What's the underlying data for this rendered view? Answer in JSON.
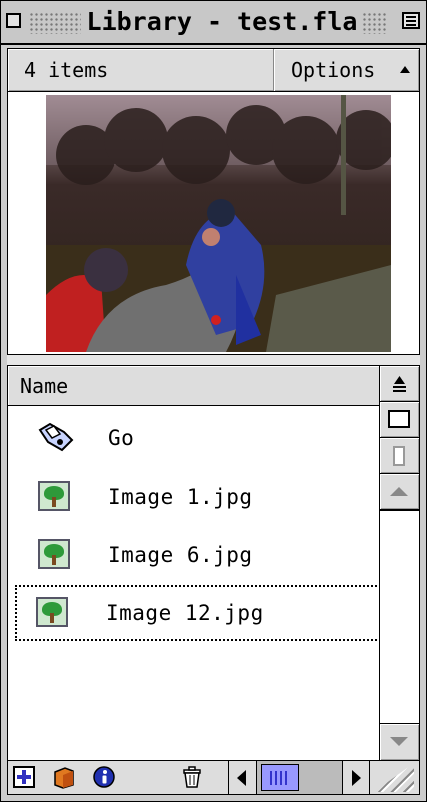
{
  "window": {
    "title": "Library - test.fla"
  },
  "header": {
    "item_count": "4 items",
    "options_label": "Options"
  },
  "list": {
    "column_header": "Name",
    "items": [
      {
        "label": "Go",
        "icon": "button-symbol-icon"
      },
      {
        "label": "Image 1.jpg",
        "icon": "bitmap-icon"
      },
      {
        "label": "Image 6.jpg",
        "icon": "bitmap-icon"
      },
      {
        "label": "Image 12.jpg",
        "icon": "bitmap-icon",
        "selected": true
      }
    ]
  },
  "toolbar": {
    "icons": [
      "new-symbol-icon",
      "new-folder-icon",
      "properties-icon",
      "delete-icon"
    ]
  },
  "colors": {
    "chrome": "#cccccc",
    "scroll_thumb": "#9999ff"
  }
}
